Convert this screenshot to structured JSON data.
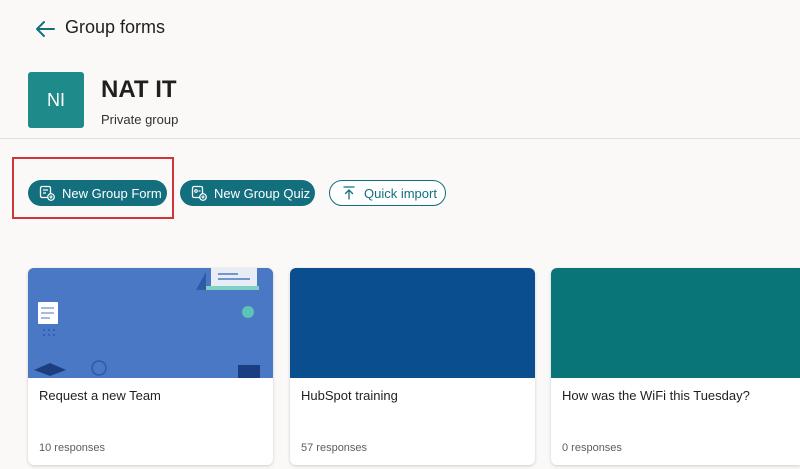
{
  "header": {
    "title": "Group forms"
  },
  "group": {
    "initials": "NI",
    "name": "NAT IT",
    "type": "Private group"
  },
  "actions": {
    "new_form": "New Group Form",
    "new_quiz": "New Group Quiz",
    "quick_import": "Quick import"
  },
  "cards": [
    {
      "title": "Request a new Team",
      "responses": "10 responses",
      "banner_color": "#4a78c4"
    },
    {
      "title": "HubSpot training",
      "responses": "57 responses",
      "banner_color": "#0b4e8f"
    },
    {
      "title": "How was the WiFi this Tuesday?",
      "responses": "0 responses",
      "banner_color": "#0a7579"
    }
  ],
  "colors": {
    "accent": "#136f7e",
    "highlight": "#d13438",
    "avatar": "#1f8a8a"
  }
}
